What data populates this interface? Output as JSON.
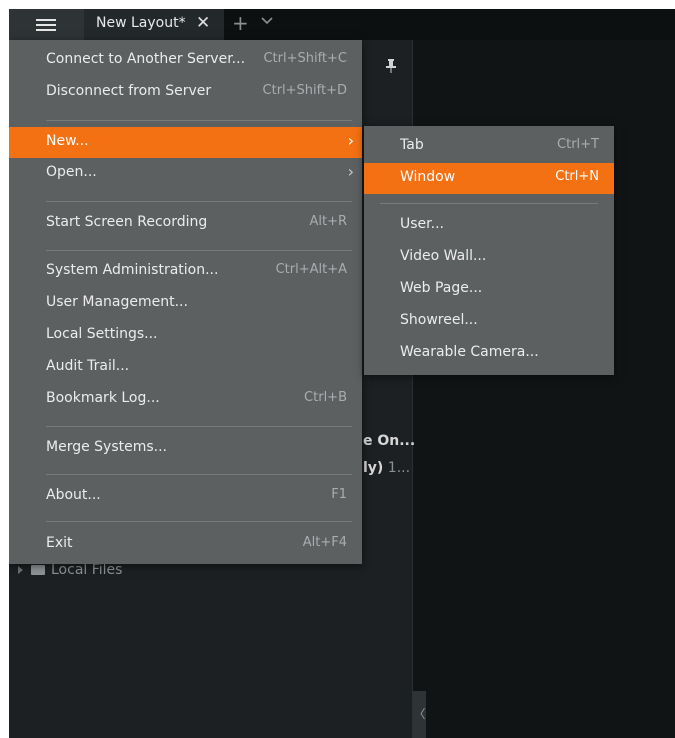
{
  "tab": {
    "label": "New Layout*",
    "close": "✕"
  },
  "add_tab": "+",
  "main_menu": {
    "items": [
      {
        "label": "Connect to Another Server...",
        "shortcut": "Ctrl+Shift+C"
      },
      {
        "label": "Disconnect from Server",
        "shortcut": "Ctrl+Shift+D"
      },
      {
        "label": "New...",
        "shortcut": ""
      },
      {
        "label": "Open...",
        "shortcut": ""
      },
      {
        "label": "Start Screen Recording",
        "shortcut": "Alt+R"
      },
      {
        "label": "System Administration...",
        "shortcut": "Ctrl+Alt+A"
      },
      {
        "label": "User Management...",
        "shortcut": ""
      },
      {
        "label": "Local Settings...",
        "shortcut": ""
      },
      {
        "label": "Audit Trail...",
        "shortcut": ""
      },
      {
        "label": "Bookmark Log...",
        "shortcut": "Ctrl+B"
      },
      {
        "label": "Merge Systems...",
        "shortcut": ""
      },
      {
        "label": "About...",
        "shortcut": "F1"
      },
      {
        "label": "Exit",
        "shortcut": "Alt+F4"
      }
    ]
  },
  "sub_menu": {
    "items": [
      {
        "label": "Tab",
        "shortcut": "Ctrl+T"
      },
      {
        "label": "Window",
        "shortcut": "Ctrl+N"
      },
      {
        "label": "User...",
        "shortcut": ""
      },
      {
        "label": "Video Wall...",
        "shortcut": ""
      },
      {
        "label": "Web Page...",
        "shortcut": ""
      },
      {
        "label": "Showreel...",
        "shortcut": ""
      },
      {
        "label": "Wearable Camera...",
        "shortcut": ""
      }
    ]
  },
  "background": {
    "partial_text_1": "e On...",
    "partial_text_2_main": "ly)",
    "partial_text_2_extra": "1...",
    "local_files": "Local Files"
  },
  "colors": {
    "highlight": "#f37013",
    "menu_bg": "#5c6061",
    "app_bg": "#111415"
  }
}
